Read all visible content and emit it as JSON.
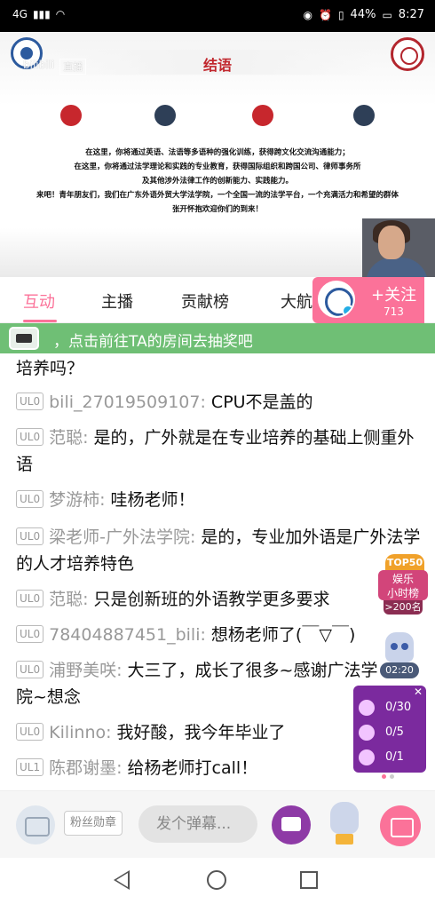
{
  "status_bar": {
    "network": "4G",
    "battery": "44%",
    "time": "8:27"
  },
  "video": {
    "title": "结语",
    "bili_mark": "bilibili",
    "live_tag": "直播",
    "lines": [
      "在这里，你将通过英语、法语等多语种的强化训练，获得跨文化交流沟通能力；",
      "在这里，你将通过法学理论和实践的专业教育，获得国际组织和跨国公司、律师事务所",
      "及其他涉外法律工作的创新能力、实践能力。",
      "来吧！青年朋友们，我们在广东外语外贸大学法学院，一个全国一流的法学平台，一个充满活力和希望的群体",
      "张开怀抱欢迎你们的到来！"
    ]
  },
  "tabs": [
    "互动",
    "主播",
    "贡献榜",
    "大航"
  ],
  "follow": {
    "label": "+关注",
    "count": "713"
  },
  "lottery_banner": "，点击前往TA的房间去抽奖吧",
  "chat": [
    {
      "level": "",
      "user": "",
      "text": "培养吗？"
    },
    {
      "level": "UL0",
      "user": "bili_27019509107:",
      "text": " CPU不是盖的"
    },
    {
      "level": "UL0",
      "user": "范聪:",
      "text": " 是的，广外就是在专业培养的基础上侧重外语"
    },
    {
      "level": "UL0",
      "user": "梦游柿:",
      "text": " 哇杨老师！"
    },
    {
      "level": "UL0",
      "user": "梁老师-广外法学院:",
      "text": " 是的，专业加外语是广外法学的人才培养特色"
    },
    {
      "level": "UL0",
      "user": "范聪:",
      "text": " 只是创新班的外语教学更多要求"
    },
    {
      "level": "UL0",
      "user": "78404887451_bili:",
      "text": " 想杨老师了(￣▽￣)"
    },
    {
      "level": "UL0",
      "user": "浦野美咲:",
      "text": " 大三了，成长了很多~感谢广法学院~想念"
    },
    {
      "level": "UL0",
      "user": "Kilinno:",
      "text": " 我好酸，我今年毕业了"
    },
    {
      "level": "UL1",
      "user": "陈郡谢墨:",
      "text": " 给杨老师打call！"
    }
  ],
  "side_widgets": {
    "rank_top": "TOP50",
    "rank_label_1": "娱乐",
    "rank_label_2": "小时榜",
    "rank_position": ">200名",
    "countdown": "02:20",
    "tasks": [
      "0/30",
      "0/5",
      "0/1"
    ]
  },
  "bottom_bar": {
    "fans_badge": "粉丝勋章",
    "danmaku_placeholder": "发个弹幕..."
  },
  "colors": {
    "accent": "#fb7299",
    "banner": "#6fbf75"
  }
}
